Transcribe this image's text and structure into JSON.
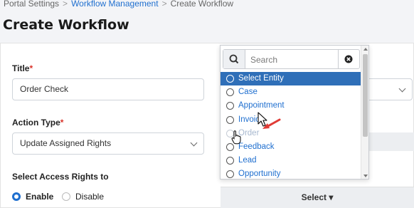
{
  "breadcrumb": {
    "root": "Portal Settings",
    "section": "Workflow Management",
    "current": "Create Workflow"
  },
  "page_title": "Create Workflow",
  "form": {
    "title_label": "Title",
    "required_mark": "*",
    "title_value": "Order Check",
    "action_type_label": "Action Type",
    "action_type_value": "Update Assigned Rights",
    "access_rights_label": "Select Access Rights to",
    "enable_label": "Enable",
    "disable_label": "Disable",
    "enable_selected": true,
    "select_button_label": "Select ▾"
  },
  "dropdown": {
    "search_placeholder": "Search",
    "options": [
      {
        "label": "Select Entity",
        "state": "active"
      },
      {
        "label": "Case",
        "state": "normal"
      },
      {
        "label": "Appointment",
        "state": "normal"
      },
      {
        "label": "Invoice",
        "state": "normal"
      },
      {
        "label": "Order",
        "state": "disabled"
      },
      {
        "label": "Feedback",
        "state": "normal"
      },
      {
        "label": "Lead",
        "state": "normal"
      },
      {
        "label": "Opportunity",
        "state": "normal"
      }
    ]
  },
  "colors": {
    "accent": "#1f6fcf",
    "active_option": "#2f6fb8",
    "required": "#d9342b",
    "annotation_arrow": "#e03b36"
  }
}
